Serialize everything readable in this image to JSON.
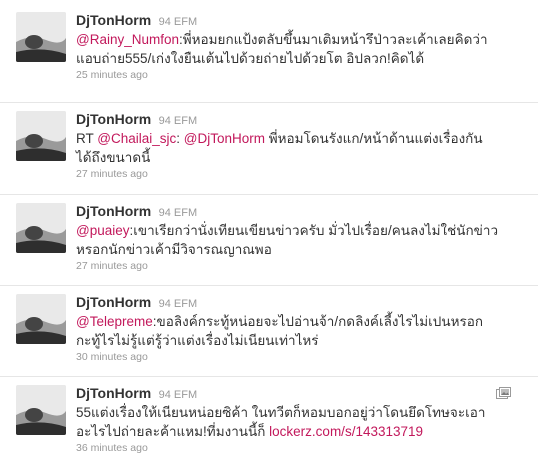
{
  "tweets": [
    {
      "screen_name": "DjTonHorm",
      "full_name": "94 EFM",
      "mention": "@Rainy_Numfon",
      "line1_after": ":พี่หอมยกแป้งตลับขึ้นมาเติมหน้ารึป่าวละเค้าเลยคิดว่า",
      "line2": "แอบถ่าย555/เก่งใงยืนเต้นไปด้วยถ่ายไปด้วยโต อิปลวก!คิดได้",
      "time": "25 minutes ago"
    },
    {
      "screen_name": "DjTonHorm",
      "full_name": "94 EFM",
      "prefix": "RT ",
      "mention": "@Chailai_sjc",
      "mid": ": ",
      "mention2": "@DjTonHorm",
      "line1_after": " พี่หอมโดนรังแก/หน้าด้านแต่งเรื่องกัน",
      "line2": "ได้ถึงขนาดนี้",
      "time": "27 minutes ago"
    },
    {
      "screen_name": "DjTonHorm",
      "full_name": "94 EFM",
      "mention": "@puaiey",
      "line1_after": ":เขาเรียกว่านั่งเทียนเขียนข่าวครับ มั่วไปเรื่อย/คนลงไม่ใช่นักข่าว",
      "line2": "หรอกนักข่าวเค้ามีวิจารณญาณพอ",
      "time": "27 minutes ago"
    },
    {
      "screen_name": "DjTonHorm",
      "full_name": "94 EFM",
      "mention": "@Telepreme",
      "line1_after": ":ขอลิงค์กระทู้หน่อยจะไปอ่านจ้า/กดลิงค์เลี้งไรไม่เปนหรอก",
      "line2": "กะทู้ไรไม่รู้แต่รู้ว่าแต่งเรื่องไม่เนียนเท่าไหร่",
      "time": "30 minutes ago"
    },
    {
      "screen_name": "DjTonHorm",
      "full_name": "94 EFM",
      "line1": "55แต่งเรื่องให้เนียนหน่อยซิค้า ในทวีตก็หอมบอกอยู่ว่าโดนยึดโทษจะเอา",
      "line2_before": "อะไรไปถ่ายละค้าแหม!ที่มงานนี้ก็ ",
      "link": "lockerz.com/s/143313719",
      "time": "36 minutes ago"
    }
  ]
}
